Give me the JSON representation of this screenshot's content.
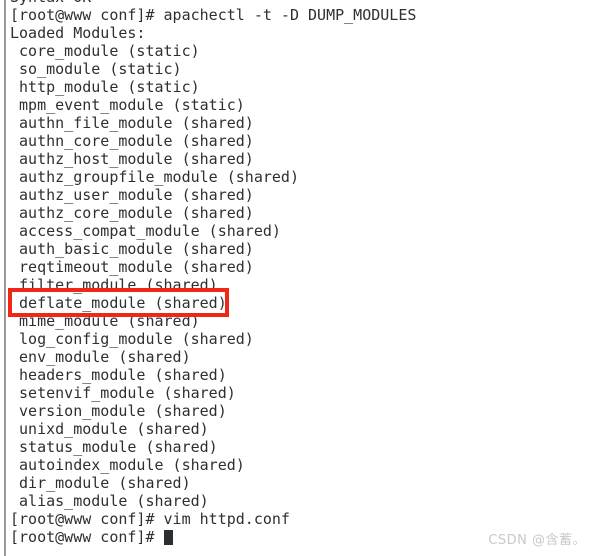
{
  "terminal": {
    "background_color": "#ffffff",
    "text_color": "#2c3033",
    "highlight_color": "#f02617",
    "lines": [
      {
        "text": "Syntax OK",
        "indent": false
      },
      {
        "text": "[root@www conf]# apachectl -t -D DUMP_MODULES",
        "indent": false
      },
      {
        "text": "Loaded Modules:",
        "indent": false
      },
      {
        "text": " core_module (static)",
        "indent": false
      },
      {
        "text": " so_module (static)",
        "indent": false
      },
      {
        "text": " http_module (static)",
        "indent": false
      },
      {
        "text": " mpm_event_module (static)",
        "indent": false
      },
      {
        "text": " authn_file_module (shared)",
        "indent": false
      },
      {
        "text": " authn_core_module (shared)",
        "indent": false
      },
      {
        "text": " authz_host_module (shared)",
        "indent": false
      },
      {
        "text": " authz_groupfile_module (shared)",
        "indent": false
      },
      {
        "text": " authz_user_module (shared)",
        "indent": false
      },
      {
        "text": " authz_core_module (shared)",
        "indent": false
      },
      {
        "text": " access_compat_module (shared)",
        "indent": false
      },
      {
        "text": " auth_basic_module (shared)",
        "indent": false
      },
      {
        "text": " reqtimeout_module (shared)",
        "indent": false
      },
      {
        "text": " filter_module (shared)",
        "indent": false
      },
      {
        "text": " deflate_module (shared)",
        "indent": false
      },
      {
        "text": " mime_module (shared)",
        "indent": false
      },
      {
        "text": " log_config_module (shared)",
        "indent": false
      },
      {
        "text": " env_module (shared)",
        "indent": false
      },
      {
        "text": " headers_module (shared)",
        "indent": false
      },
      {
        "text": " setenvif_module (shared)",
        "indent": false
      },
      {
        "text": " version_module (shared)",
        "indent": false
      },
      {
        "text": " unixd_module (shared)",
        "indent": false
      },
      {
        "text": " status_module (shared)",
        "indent": false
      },
      {
        "text": " autoindex_module (shared)",
        "indent": false
      },
      {
        "text": " dir_module (shared)",
        "indent": false
      },
      {
        "text": " alias_module (shared)",
        "indent": false
      },
      {
        "text": "[root@www conf]# vim httpd.conf",
        "indent": false
      }
    ],
    "prompt_line": {
      "prompt": "[root@www conf]# ",
      "typed": ""
    },
    "highlight": {
      "target_text": "deflate_module (shared)"
    }
  },
  "watermark": {
    "text": "CSDN @含蓄。"
  }
}
